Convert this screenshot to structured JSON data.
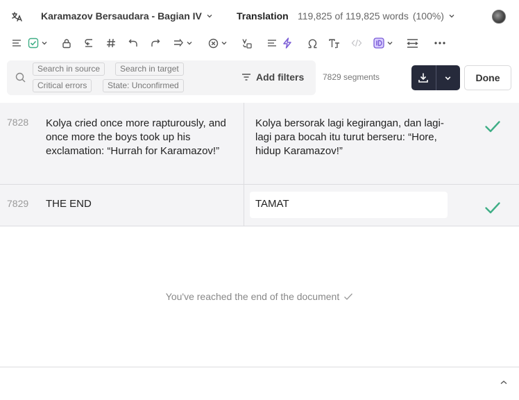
{
  "header": {
    "logo_icon": "translation-logo-icon",
    "doc_title": "Karamazov Bersaudara - Bagian IV",
    "mode": "Translation",
    "word_count": "119,825 of 119,825 words",
    "word_percent": "(100%)"
  },
  "toolbar": {
    "icons": [
      "list-icon",
      "check-square-icon",
      "lock-icon",
      "insert-source-icon",
      "hash-icon",
      "undo-icon",
      "redo-icon",
      "shift-icon",
      "clear-icon",
      "transform-icon",
      "align-icon",
      "lightning-icon",
      "omega-icon",
      "text-size-icon",
      "code-icon",
      "id-tag-icon",
      "wrap-icon",
      "more-icon"
    ],
    "accent_color": "#7a5cd6"
  },
  "filters": {
    "search_source": "Search in source",
    "search_target": "Search in target",
    "critical_errors": "Critical errors",
    "state": "State: Unconfirmed",
    "add_filters": "Add filters",
    "segments_count": "7829 segments"
  },
  "actions": {
    "done": "Done"
  },
  "segments": [
    {
      "number": "7828",
      "source": "Kolya cried once more rapturously, and once more the boys took up his exclamation: “Hurrah for Karamazov!”",
      "target": "Kolya bersorak lagi kegirangan, dan lagi-lagi para bocah itu turut berseru: “Hore, hidup Karamazov!”",
      "status": "confirmed"
    },
    {
      "number": "7829",
      "source": "THE END",
      "target": "TAMAT",
      "status": "confirmed"
    }
  ],
  "end_message": "You've reached the end of the document",
  "colors": {
    "confirmed_check": "#3fae86",
    "primary_button": "#262a3b"
  }
}
